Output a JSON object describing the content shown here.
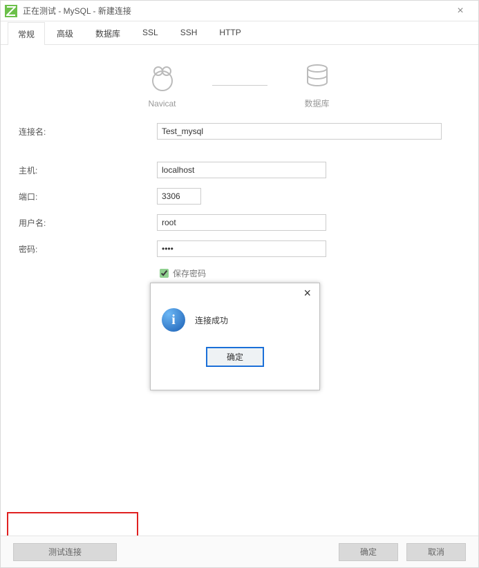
{
  "window": {
    "title": "正在测试 - MySQL - 新建连接"
  },
  "tabs": [
    "常规",
    "高级",
    "数据库",
    "SSL",
    "SSH",
    "HTTP"
  ],
  "active_tab": 0,
  "diagram": {
    "left_label": "Navicat",
    "right_label": "数据库"
  },
  "form": {
    "connection_name_label": "连接名:",
    "connection_name_value": "Test_mysql",
    "host_label": "主机:",
    "host_value": "localhost",
    "port_label": "端口:",
    "port_value": "3306",
    "user_label": "用户名:",
    "user_value": "root",
    "password_label": "密码:",
    "password_value": "••••",
    "save_password_label": "保存密码"
  },
  "buttons": {
    "test": "测试连接",
    "ok": "确定",
    "cancel": "取消"
  },
  "modal": {
    "message": "连接成功",
    "ok": "确定"
  }
}
